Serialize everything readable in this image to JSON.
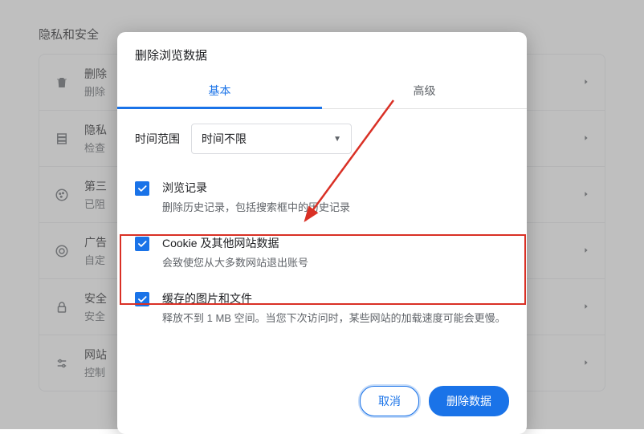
{
  "section": {
    "heading": "隐私和安全"
  },
  "bg_items": [
    {
      "icon": "trash",
      "title": "删除",
      "subtitle": "删除"
    },
    {
      "icon": "security",
      "title": "隐私",
      "subtitle": "检查"
    },
    {
      "icon": "cookie",
      "title": "第三",
      "subtitle": "已阻"
    },
    {
      "icon": "ads",
      "title": "广告",
      "subtitle": "自定"
    },
    {
      "icon": "lock",
      "title": "安全",
      "subtitle": "安全"
    },
    {
      "icon": "sliders",
      "title": "网站",
      "subtitle": "控制"
    }
  ],
  "dialog": {
    "title": "删除浏览数据",
    "tabs": {
      "basic": "基本",
      "advanced": "高级"
    },
    "time": {
      "label": "时间范围",
      "value": "时间不限"
    },
    "options": [
      {
        "title": "浏览记录",
        "sub": "删除历史记录，包括搜索框中的历史记录",
        "checked": true
      },
      {
        "title": "Cookie 及其他网站数据",
        "sub": "会致使您从大多数网站退出账号",
        "checked": true
      },
      {
        "title": "缓存的图片和文件",
        "sub": "释放不到 1 MB 空间。当您下次访问时，某些网站的加载速度可能会更慢。",
        "checked": true
      }
    ],
    "buttons": {
      "cancel": "取消",
      "confirm": "删除数据"
    }
  }
}
